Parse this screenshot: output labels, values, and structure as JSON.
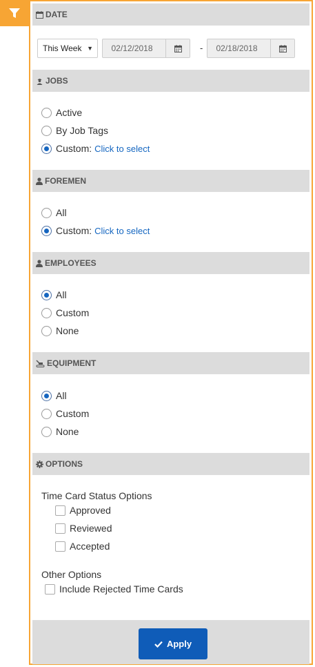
{
  "filter_tab": {
    "icon": "filter-icon",
    "color": "#f7a534"
  },
  "date": {
    "header": "DATE",
    "range_select": "This Week",
    "start_date": "02/12/2018",
    "end_date": "02/18/2018",
    "separator": "-"
  },
  "jobs": {
    "header": "JOBS",
    "options": [
      "Active",
      "By Job Tags",
      "Custom:"
    ],
    "selected": "Custom:",
    "custom_link": "Click to select"
  },
  "foremen": {
    "header": "FOREMEN",
    "options": [
      "All",
      "Custom:"
    ],
    "selected": "Custom:",
    "custom_link": "Click to select"
  },
  "employees": {
    "header": "EMPLOYEES",
    "options": [
      "All",
      "Custom",
      "None"
    ],
    "selected": "All"
  },
  "equipment": {
    "header": "EQUIPMENT",
    "options": [
      "All",
      "Custom",
      "None"
    ],
    "selected": "All"
  },
  "options": {
    "header": "OPTIONS",
    "status_label": "Time Card Status Options",
    "status_checks": [
      "Approved",
      "Reviewed",
      "Accepted"
    ],
    "other_label": "Other Options",
    "other_checks": [
      "Include Rejected Time Cards"
    ]
  },
  "footer": {
    "apply_label": "Apply"
  },
  "colors": {
    "accent": "#f7a534",
    "primary_button": "#0f5cb8",
    "link": "#1466c0",
    "section_bg": "#dcdcdc"
  }
}
